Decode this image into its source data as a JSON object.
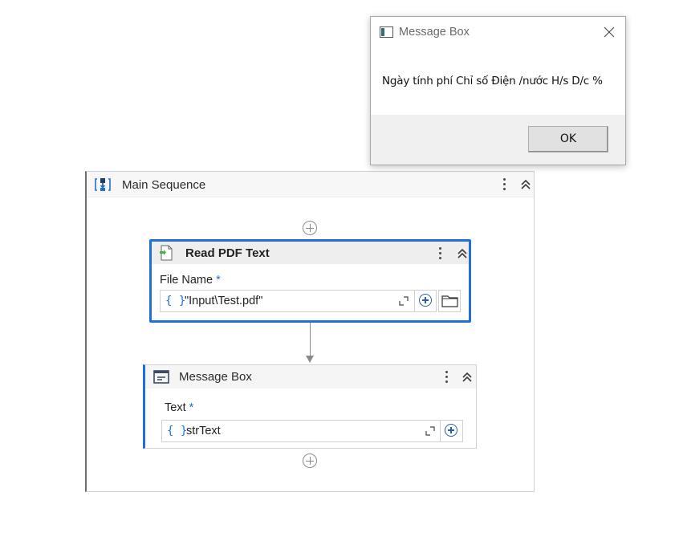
{
  "sequence": {
    "title": "Main Sequence"
  },
  "read_pdf": {
    "title": "Read PDF Text",
    "field_label": "File Name",
    "required_mark": "*",
    "brace": "{ }",
    "value": "\"Input\\Test.pdf\""
  },
  "message_activity": {
    "title": "Message Box",
    "field_label": "Text",
    "required_mark": "*",
    "brace": "{ }",
    "value": "strText"
  },
  "dialog": {
    "title": "Message Box",
    "text": "Ngày tính phí Chỉ số Điện /nước H/s D/c %",
    "ok_label": "OK"
  },
  "colors": {
    "accent": "#1e6fd9",
    "add_icon": "#2a5fa8",
    "header_bg": "#eeeeee",
    "dialog_footer": "#f0f0f0"
  },
  "icons": {
    "sequence": "sequence-icon",
    "read_pdf": "pdf-document-icon",
    "message": "message-box-icon",
    "dialog": "window-app-icon",
    "close": "close-icon",
    "expand": "expand-editor-icon",
    "add": "plus-circle-icon",
    "browse": "folder-icon",
    "collapse": "chevron-double-up-icon",
    "menu": "kebab-menu-icon"
  }
}
